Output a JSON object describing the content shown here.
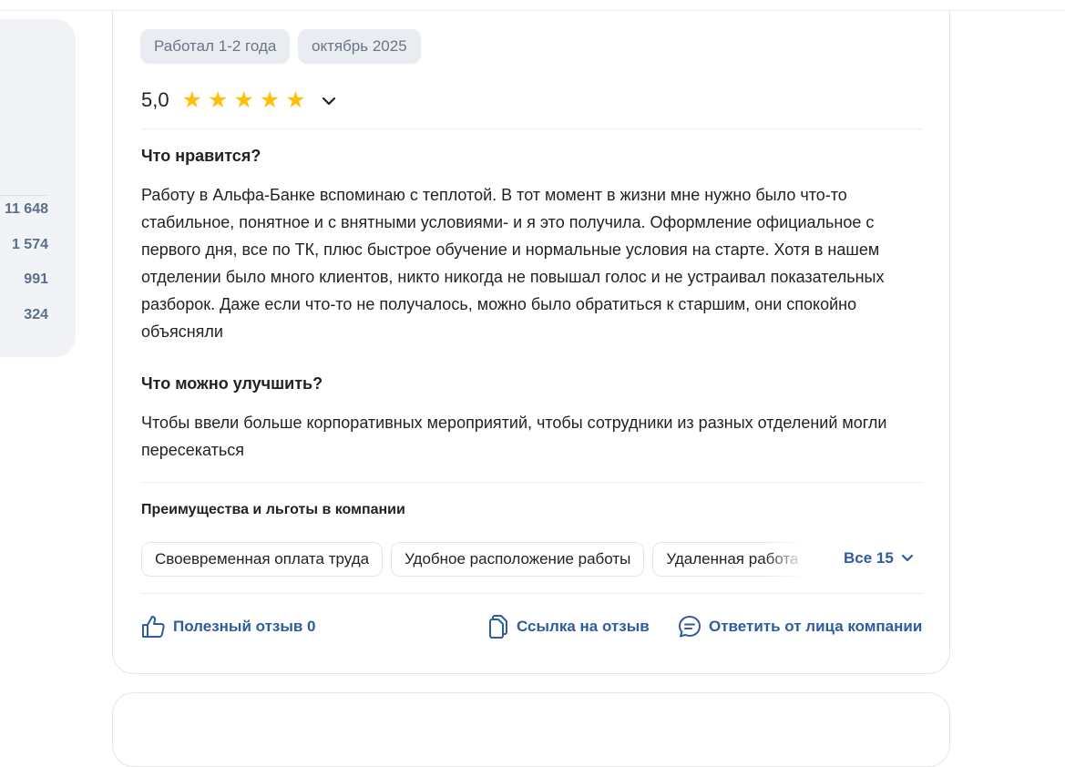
{
  "stats": {
    "values": [
      "11 648",
      "1 574",
      "991",
      "324"
    ]
  },
  "review": {
    "tags": [
      "Работал 1-2 года",
      "октябрь 2025"
    ],
    "rating": "5,0",
    "stars_filled": 5,
    "likes_heading": "Что нравится?",
    "likes_text": "Работу в Альфа-Банке вспоминаю с теплотой. В тот момент в жизни мне нужно было что-то стабильное, понятное и с внятными условиями- и я это получила. Оформление официальное с первого дня, все по ТК, плюс быстрое обучение и нормальные условия на старте. Хотя в нашем отделении было много клиентов, никто никогда не повышал голос и не устраивал показательных разборок. Даже если что-то не получалось, можно было обратиться к старшим, они спокойно объясняли",
    "improve_heading": "Что можно улучшить?",
    "improve_text": "Чтобы ввели больше корпоративных мероприятий, чтобы сотрудники из разных отделений могли пересекаться",
    "benefits_title": "Преимущества и льготы в компании",
    "benefits": [
      "Своевременная оплата труда",
      "Удобное расположение работы",
      "Удаленная работа"
    ],
    "benefits_all": "Все 15",
    "actions": {
      "useful": "Полезный отзыв 0",
      "link": "Ссылка на отзыв",
      "reply": "Ответить от лица компании"
    }
  },
  "colors": {
    "accent": "#2f5b9f",
    "star": "#ffbf0b",
    "tag_bg": "#e9edf2",
    "panel_bg": "#f1f3f7"
  }
}
